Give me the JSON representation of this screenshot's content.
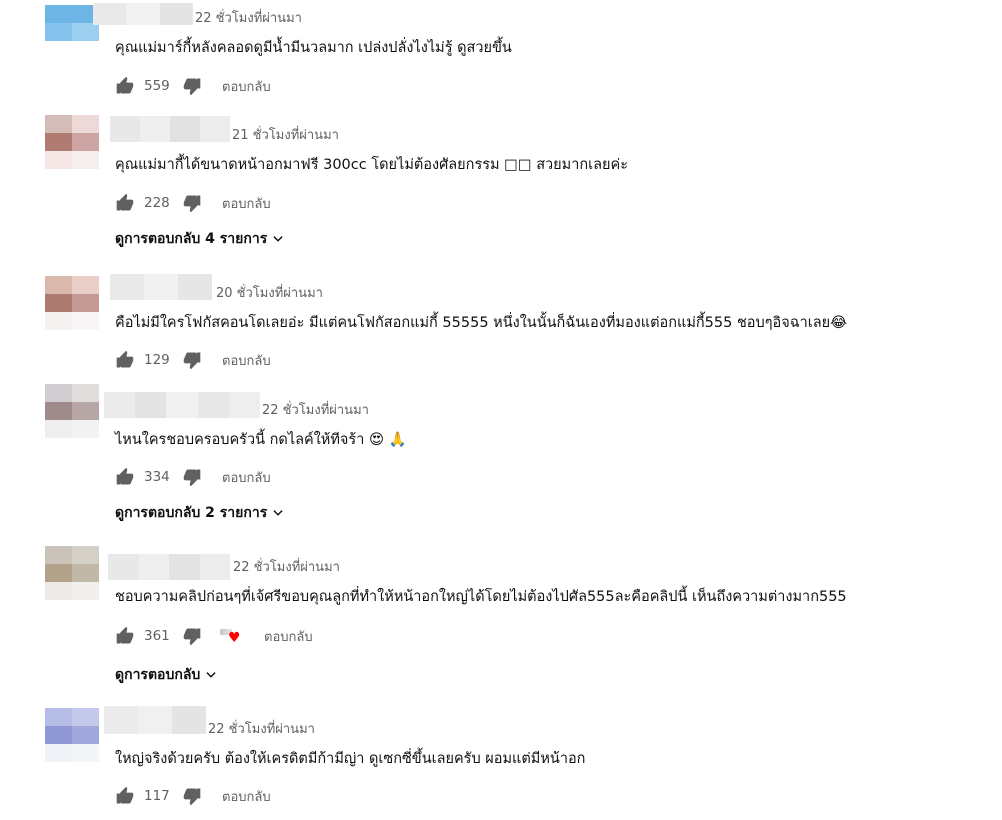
{
  "comments": [
    {
      "time": "22 ชั่วโมงที่ผ่านมา",
      "text": "คุณแม่มาร์กี้หลังคลอดดูมีน้ำมีนวลมาก เปล่งปลั่งไงไม่รู้ ดูสวยขึ้น",
      "likes": "559",
      "reply_label": "ตอบกลับ"
    },
    {
      "time": "21 ชั่วโมงที่ผ่านมา",
      "text": "คุณแม่มากี้ได้ขนาดหน้าอกมาฟรี 300cc โดยไม่ต้องศัลยกรรม □□ สวยมากเลยค่ะ",
      "likes": "228",
      "reply_label": "ตอบกลับ",
      "view_replies": "ดูการตอบกลับ 4 รายการ"
    },
    {
      "time": "20 ชั่วโมงที่ผ่านมา",
      "text": "คือไม่มีใครโฟกัสคอนโดเลยอ่ะ มีแต่คนโฟกัสอกแม่กี้ 55555  หนึ่งในนั้นก็ฉันเองที่มองแต่อกแม่กี้555 ชอบๆอิจฉาเลย😂",
      "likes": "129",
      "reply_label": "ตอบกลับ"
    },
    {
      "time": "22 ชั่วโมงที่ผ่านมา",
      "text": "ไหนใครชอบครอบครัวนี้ กดไลค์ให้ทีจร้า 😍 🙏",
      "likes": "334",
      "reply_label": "ตอบกลับ",
      "view_replies": "ดูการตอบกลับ 2 รายการ"
    },
    {
      "time": "22 ชั่วโมงที่ผ่านมา",
      "text": "ชอบความคลิปก่อนๆที่เจ้ศรีขอบคุณลูกที่ทำให้หน้าอกใหญ่ได้โดยไม่ต้องไปศัล555ละคือคลิปนี้ เห็นถึงความต่างมาก555",
      "likes": "361",
      "reply_label": "ตอบกลับ",
      "view_replies": "ดูการตอบกลับ"
    },
    {
      "time": "22 ชั่วโมงที่ผ่านมา",
      "text": "ใหญ่จริงด้วยครับ ต้องให้เครดิตมีก้ามีญ่า ดูเซกซี่ขึ้นเลยครับ ผอมแต่มีหน้าอก",
      "likes": "117",
      "reply_label": "ตอบกลับ"
    }
  ],
  "icons": {
    "like": "thumbs-up-icon",
    "dislike": "thumbs-down-icon",
    "expand": "chevron-down-icon",
    "creator_heart": "creator-heart-icon"
  },
  "colors": {
    "meta_text": "#606060",
    "main_text": "#0f0f0f",
    "heart": "#ff0000"
  }
}
